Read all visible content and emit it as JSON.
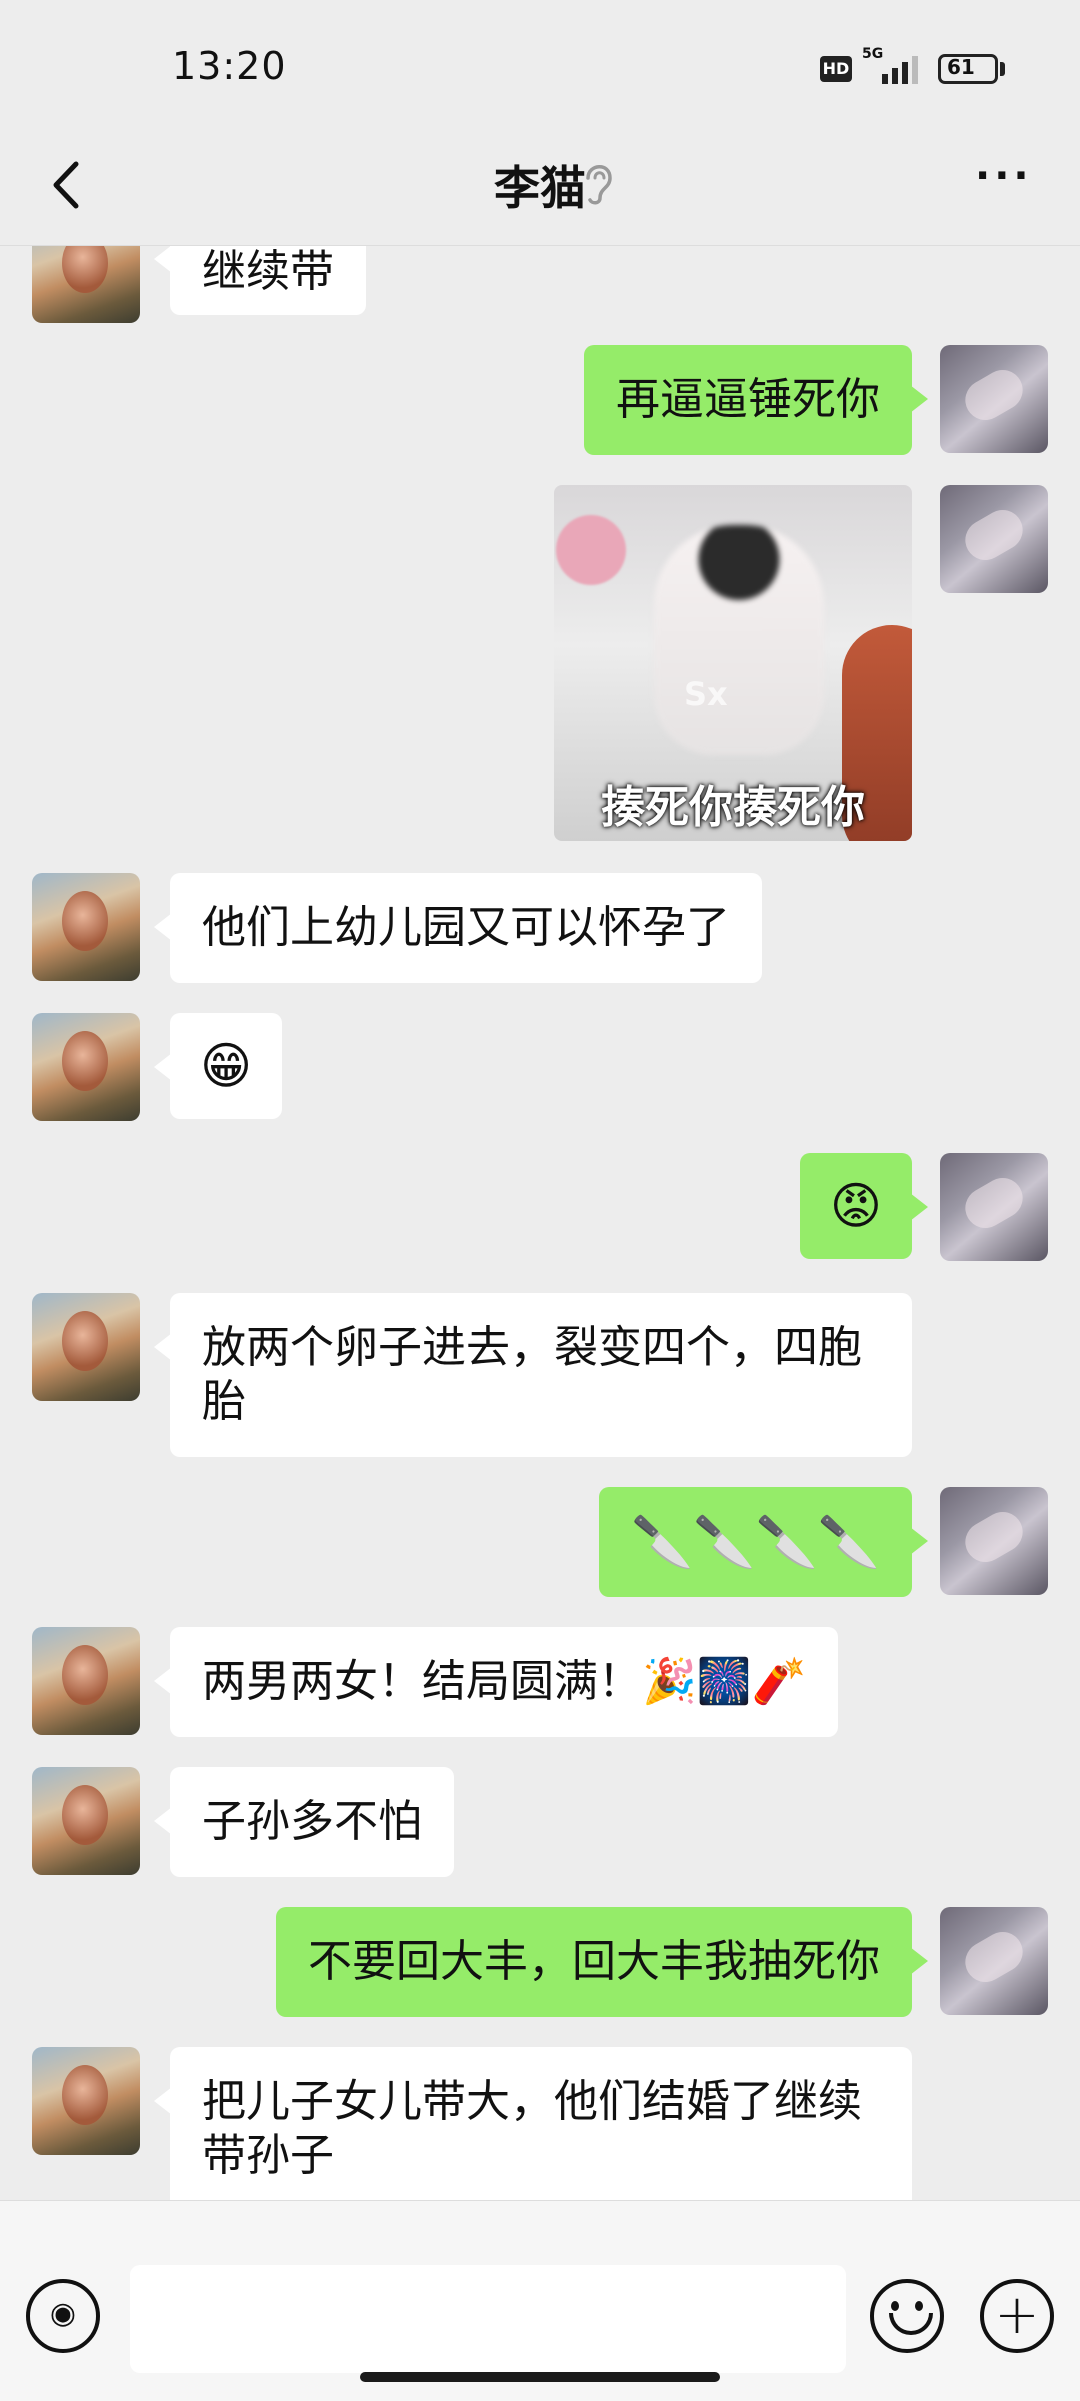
{
  "status_bar": {
    "time": "13:20",
    "hd": "HD",
    "network": "5G",
    "battery": "61"
  },
  "nav": {
    "title": "李猫"
  },
  "messages": [
    {
      "side": "left",
      "text": "继续带"
    },
    {
      "side": "right",
      "text": "再逼逼锤死你"
    },
    {
      "side": "right",
      "type": "sticker",
      "caption": "揍死你揍死你",
      "watermark": "Sx"
    },
    {
      "side": "left",
      "text": "他们上幼儿园又可以怀孕了"
    },
    {
      "side": "left",
      "text": "😁"
    },
    {
      "side": "right",
      "text": "😡"
    },
    {
      "side": "left",
      "text": "放两个卵子进去，裂变四个，四胞胎"
    },
    {
      "side": "right",
      "text": "🔪🔪🔪🔪"
    },
    {
      "side": "left",
      "text": "两男两女！结局圆满！🎉🎆🧨"
    },
    {
      "side": "left",
      "text": "子孙多不怕"
    },
    {
      "side": "right",
      "text": "不要回大丰，回大丰我抽死你"
    },
    {
      "side": "left",
      "text": "把儿子女儿带大，他们结婚了继续带孙子"
    }
  ],
  "input": {
    "value": ""
  },
  "icons": {
    "back": "back-arrow-icon",
    "ear": "ear-icon",
    "more": "more-dots-icon",
    "voice": "voice-icon",
    "emoji": "emoji-icon",
    "plus": "plus-icon"
  }
}
